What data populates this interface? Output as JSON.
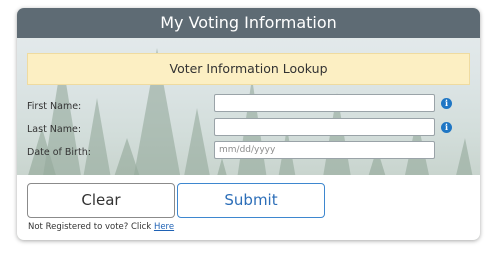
{
  "header": {
    "title": "My Voting Information"
  },
  "banner": {
    "text": "Voter Information Lookup"
  },
  "form": {
    "first_name": {
      "label": "First Name:",
      "value": ""
    },
    "last_name": {
      "label": "Last Name:",
      "value": ""
    },
    "dob": {
      "label": "Date of Birth:",
      "value": "",
      "placeholder": "mm/dd/yyyy"
    },
    "info_glyph": "i"
  },
  "buttons": {
    "clear": "Clear",
    "submit": "Submit"
  },
  "footer": {
    "prompt": "Not Registered to vote? Click ",
    "link": "Here"
  },
  "colors": {
    "header_bg": "#5e6b74",
    "banner_bg": "#fcefc3",
    "info_icon": "#1f76c4",
    "submit_accent": "#2c6eb8"
  }
}
